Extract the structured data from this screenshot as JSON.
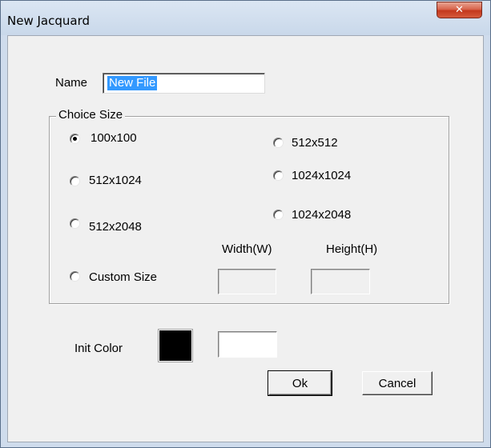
{
  "window": {
    "title": "New Jacquard",
    "close_glyph": "✕"
  },
  "name": {
    "label": "Name",
    "value": "New File"
  },
  "choice_size": {
    "legend": "Choice Size",
    "selected": "100x100",
    "options": [
      "100x100",
      "512x512",
      "512x1024",
      "1024x1024",
      "512x2048",
      "1024x2048",
      "Custom Size"
    ],
    "width_label": "Width(W)",
    "height_label": "Height(H)",
    "width_value": "",
    "height_value": ""
  },
  "init_color": {
    "label": "Init Color",
    "swatch_color": "#000000",
    "value": ""
  },
  "buttons": {
    "ok": "Ok",
    "cancel": "Cancel"
  }
}
